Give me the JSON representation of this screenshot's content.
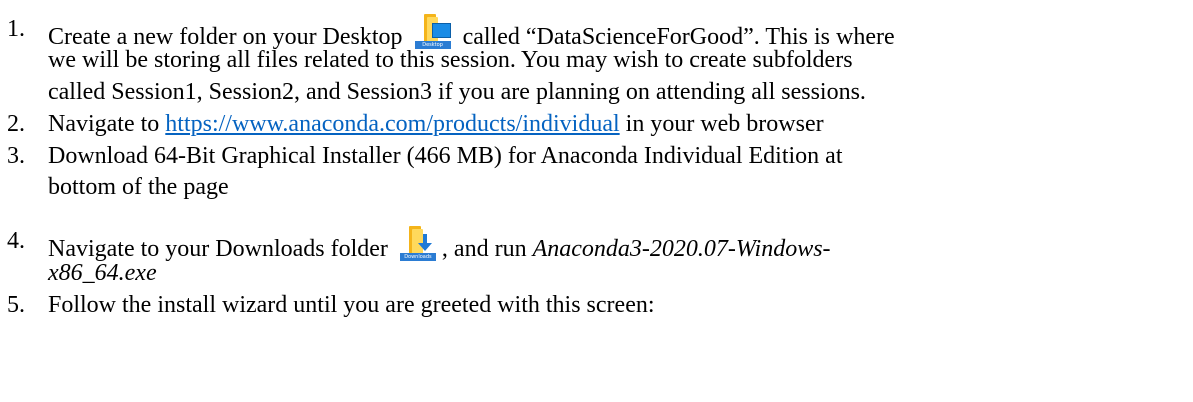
{
  "steps": [
    {
      "number": "1.",
      "line1_before": "Create a new folder on your Desktop ",
      "icon_caption": "Desktop",
      "icon_name": "desktop-folder-icon",
      "line1_after": " called “DataScienceForGood”. This is where",
      "line2": "we will be storing all files related to this session. You may wish to create subfolders",
      "line3": "called Session1, Session2, and Session3 if you are planning on attending all sessions."
    },
    {
      "number": "2.",
      "before": "Navigate to ",
      "link": "https://www.anaconda.com/products/individual",
      "after": " in your web browser"
    },
    {
      "number": "3.",
      "line1": "Download 64-Bit Graphical Installer (466 MB) for Anaconda Individual Edition at",
      "line2": "bottom of the page"
    },
    {
      "number": "4.",
      "before": "Navigate to your Downloads folder ",
      "icon_caption": "Downloads",
      "icon_name": "downloads-folder-icon",
      "middle": ", and run ",
      "filename_part1": "Anaconda3-2020.07-Windows-",
      "filename_part2": "x86_64.exe"
    },
    {
      "number": "5.",
      "text": "Follow the install wizard until you are greeted with this screen:"
    }
  ],
  "colors": {
    "link": "#0563c1",
    "text": "#000000",
    "icon_caption_bg": "#2b7cd3",
    "folder_back": "#f4b41a",
    "folder_front": "#ffd95c"
  }
}
